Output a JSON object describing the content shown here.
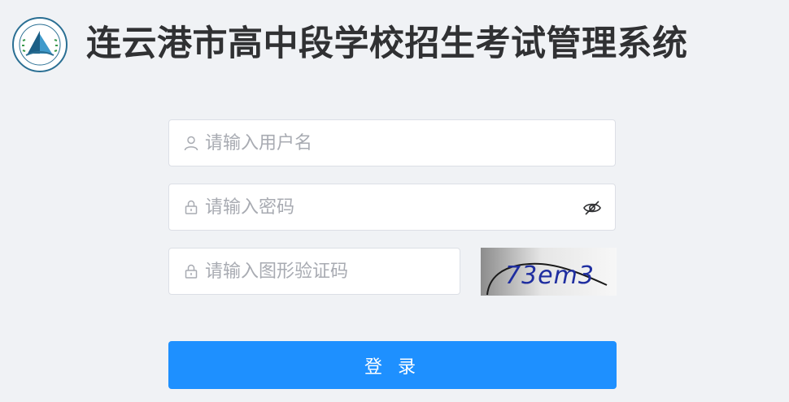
{
  "header": {
    "title": "连云港市高中段学校招生考试管理系统",
    "logo_icon": "school-logo-icon"
  },
  "form": {
    "username": {
      "placeholder": "请输入用户名",
      "value": "",
      "icon": "user-icon"
    },
    "password": {
      "placeholder": "请输入密码",
      "value": "",
      "icon": "lock-icon",
      "toggle_icon": "eye-hidden-icon"
    },
    "captcha": {
      "placeholder": "请输入图形验证码",
      "value": "",
      "icon": "lock-icon",
      "image_text": "73em3"
    },
    "submit_label": "登 录"
  },
  "colors": {
    "background": "#f0f2f5",
    "primary": "#1e90ff",
    "title": "#303133",
    "border": "#dcdfe6",
    "placeholder": "#a8abb2"
  }
}
